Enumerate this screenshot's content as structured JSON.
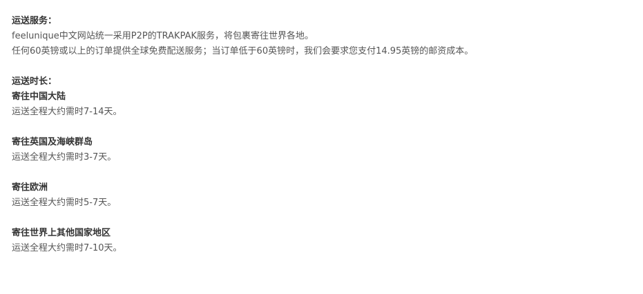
{
  "shipping_service": {
    "title": "运送服务：",
    "lines": [
      "feelunique中文网站统一采用P2P的TRAKPAK服务，将包裹寄往世界各地。",
      "任何60英镑或以上的订单提供全球免费配送服务；当订单低于60英镑时，我们会要求您支付14.95英镑的邮资成本。"
    ]
  },
  "shipping_time": {
    "title": "运送时长：",
    "regions": [
      {
        "name": "寄往中国大陆",
        "duration": "运送全程大约需时7-14天。"
      },
      {
        "name": "寄往英国及海峡群岛",
        "duration": "运送全程大约需时3-7天。"
      },
      {
        "name": "寄往欧洲",
        "duration": "运送全程大约需时5-7天。"
      },
      {
        "name": "寄往世界上其他国家地区",
        "duration": "运送全程大约需时7-10天。"
      }
    ]
  }
}
